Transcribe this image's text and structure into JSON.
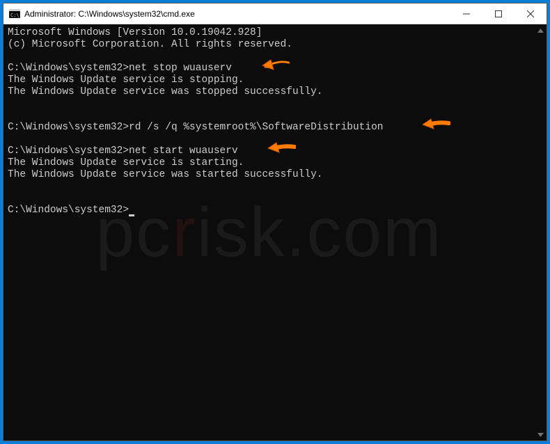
{
  "titlebar": {
    "title": "Administrator: C:\\Windows\\system32\\cmd.exe"
  },
  "terminal": {
    "header1": "Microsoft Windows [Version 10.0.19042.928]",
    "header2": "(c) Microsoft Corporation. All rights reserved.",
    "prompt": "C:\\Windows\\system32>",
    "cmd1": "net stop wuauserv",
    "out1a": "The Windows Update service is stopping.",
    "out1b": "The Windows Update service was stopped successfully.",
    "cmd2": "rd /s /q %systemroot%\\SoftwareDistribution",
    "cmd3": "net start wuauserv",
    "out3a": "The Windows Update service is starting.",
    "out3b": "The Windows Update service was started successfully."
  },
  "watermark": {
    "prefix": "pc",
    "r": "r",
    "suffix": "isk.com"
  }
}
